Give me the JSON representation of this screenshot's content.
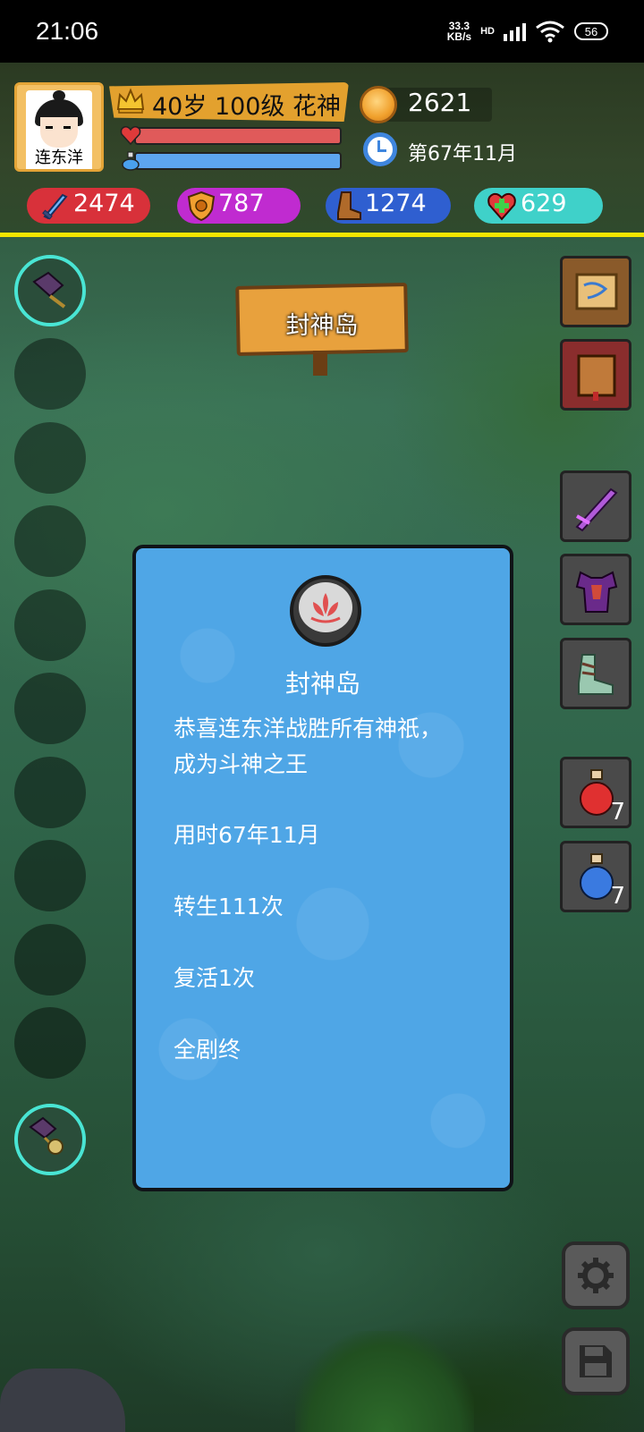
{
  "status_bar": {
    "time": "21:06",
    "net_speed_value": "33.3",
    "net_speed_unit": "KB/s",
    "network_type": "HD",
    "battery": "56"
  },
  "player": {
    "name": "连东洋",
    "level_line": "40岁 100级 花神",
    "gold": "2621",
    "game_time": "第67年11月",
    "hp_fill": 1.0,
    "mp_fill": 1.0
  },
  "stats": {
    "attack": "2474",
    "defense": "787",
    "speed": "1274",
    "health": "629"
  },
  "location_sign": "封神岛",
  "dialog": {
    "title": "封神岛",
    "line1": "恭喜连东洋战胜所有神祇，",
    "line2": "成为斗神之王",
    "time_used": "用时67年11月",
    "rebirths": "转生111次",
    "revives": "复活1次",
    "ending": "全剧终"
  },
  "inventory": {
    "red_potion_count": "7",
    "blue_potion_count": "7"
  },
  "colors": {
    "accent_yellow": "#f2e600",
    "dialog_blue": "#4fa6e6",
    "slot_ring": "#49e5d4"
  },
  "icons": {
    "top_left_slot": "war-fan-icon",
    "bottom_left_slot": "war-fan-with-relic-icon",
    "map": "map-scroll-icon",
    "book": "book-icon",
    "weapon": "sword-icon",
    "armor": "armor-icon",
    "boots": "boots-icon",
    "gear": "gear-icon",
    "save": "save-icon"
  }
}
